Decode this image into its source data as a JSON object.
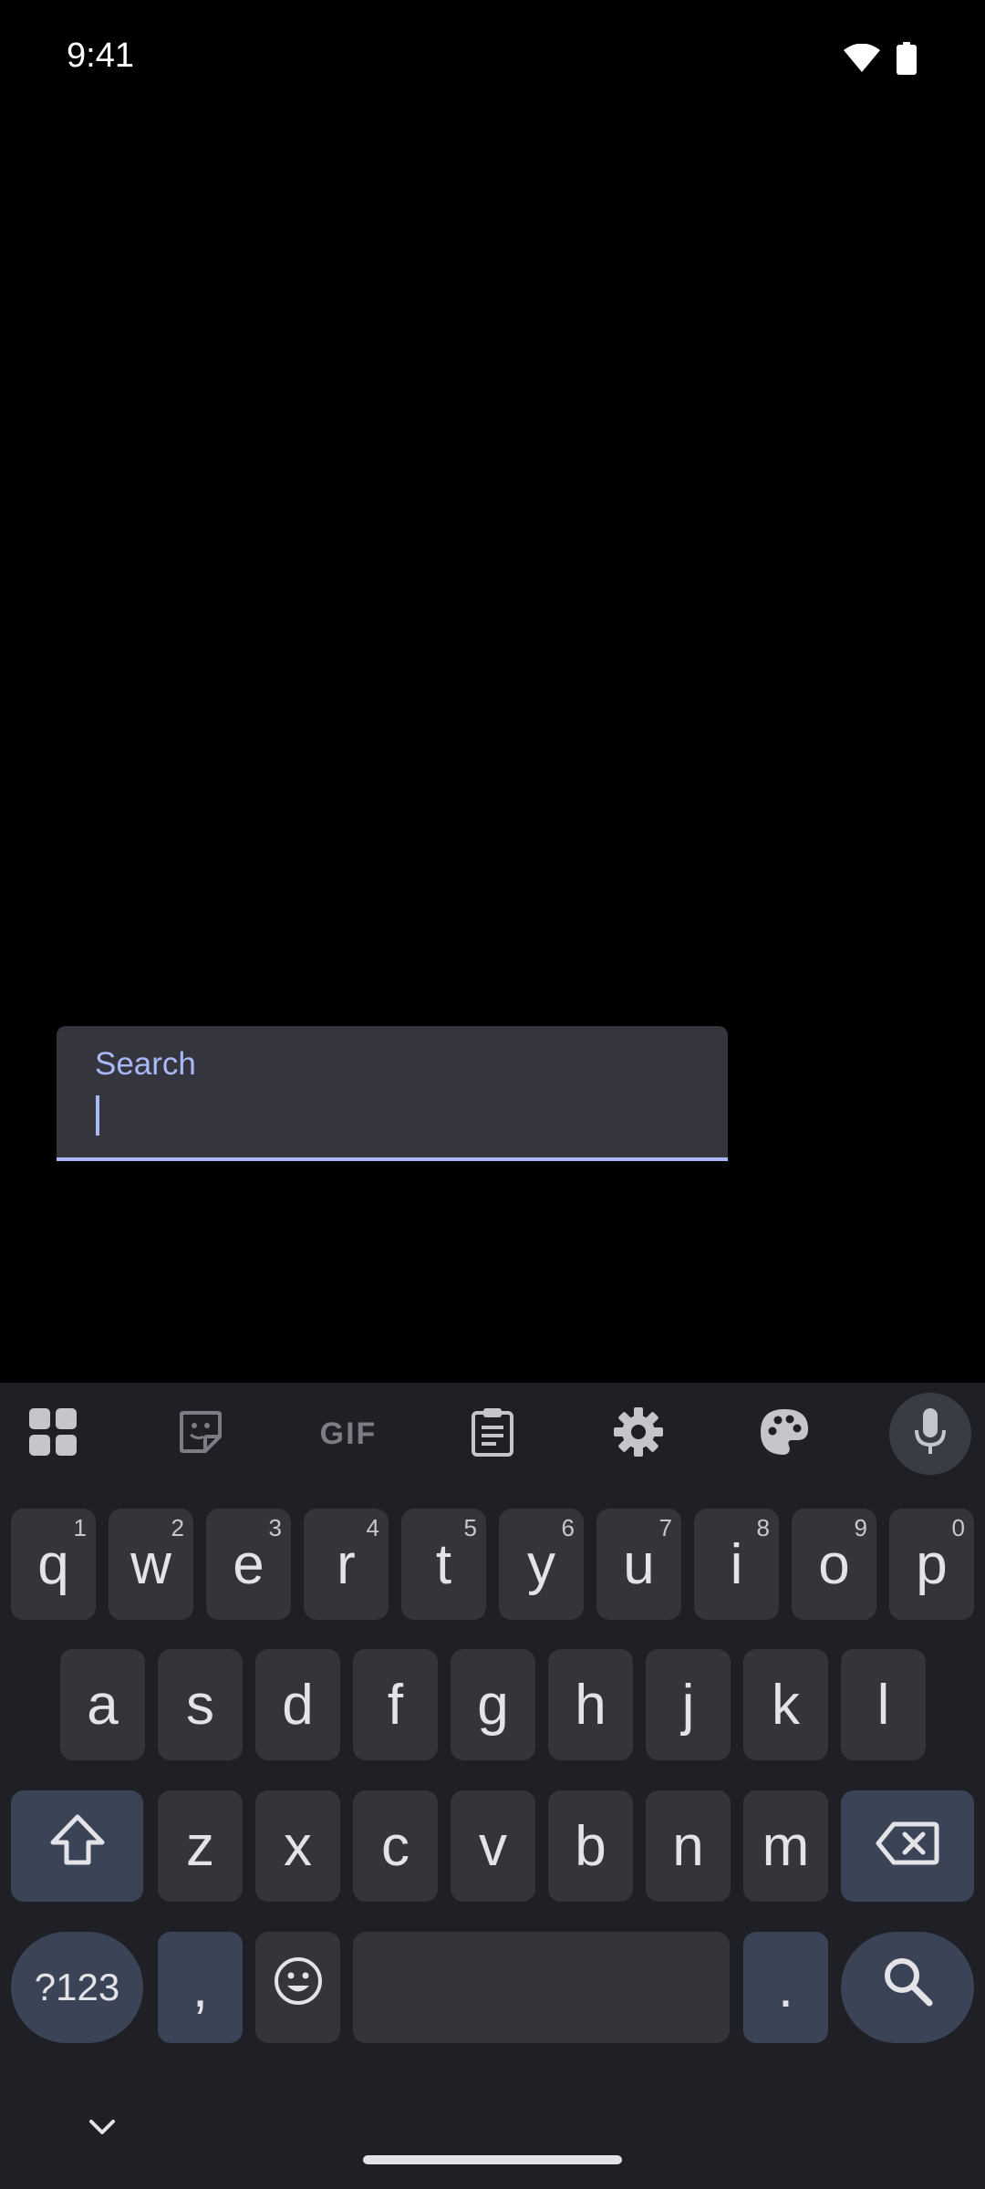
{
  "status_bar": {
    "time": "9:41",
    "icons": [
      "wifi-icon",
      "battery-icon"
    ]
  },
  "search": {
    "label": "Search",
    "value": "",
    "placeholder": ""
  },
  "keyboard": {
    "toolbar": [
      "apps-grid-icon",
      "sticker-icon",
      "gif-icon",
      "clipboard-icon",
      "settings-icon",
      "palette-icon",
      "mic-icon"
    ],
    "gif_label": "GIF",
    "row1": [
      {
        "char": "q",
        "hint": "1"
      },
      {
        "char": "w",
        "hint": "2"
      },
      {
        "char": "e",
        "hint": "3"
      },
      {
        "char": "r",
        "hint": "4"
      },
      {
        "char": "t",
        "hint": "5"
      },
      {
        "char": "y",
        "hint": "6"
      },
      {
        "char": "u",
        "hint": "7"
      },
      {
        "char": "i",
        "hint": "8"
      },
      {
        "char": "o",
        "hint": "9"
      },
      {
        "char": "p",
        "hint": "0"
      }
    ],
    "row2": [
      "a",
      "s",
      "d",
      "f",
      "g",
      "h",
      "j",
      "k",
      "l"
    ],
    "row3": [
      "z",
      "x",
      "c",
      "v",
      "b",
      "n",
      "m"
    ],
    "symbols_label": "?123",
    "comma": ",",
    "period": ".",
    "accent_color": "#aab8f7"
  }
}
